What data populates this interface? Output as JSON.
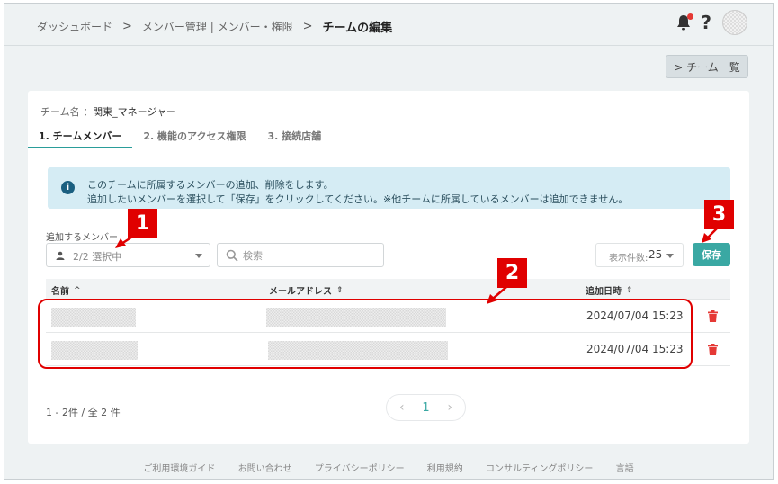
{
  "breadcrumb": {
    "items": [
      "ダッシュボード",
      "メンバー管理 | メンバー・権限"
    ],
    "separator": ">",
    "current": "チームの編集"
  },
  "header": {
    "bell_icon": "bell-icon",
    "help_label": "?"
  },
  "team_list_button": "> チーム一覧",
  "team": {
    "label": "チーム名",
    "value": "：関東_マネージャー"
  },
  "tabs": [
    {
      "label": "1. チームメンバー",
      "active": true
    },
    {
      "label": "2. 機能のアクセス権限",
      "active": false
    },
    {
      "label": "3. 接続店舗",
      "active": false
    }
  ],
  "alert": {
    "line1": "このチームに所属するメンバーの追加、削除をします。",
    "line2": "追加したいメンバーを選択して「保存」をクリックしてください。※他チームに所属しているメンバーは追加できません。"
  },
  "member_select": {
    "label": "追加するメンバー",
    "value": "2/2 選択中"
  },
  "search": {
    "placeholder": "検索"
  },
  "per_page": {
    "label": "表示件数:",
    "value": "25"
  },
  "save_label": "保存",
  "table": {
    "columns": [
      {
        "label": "名前",
        "sort": "^"
      },
      {
        "label": "メールアドレス",
        "sort": "⇕"
      },
      {
        "label": "追加日時",
        "sort": "⇕"
      }
    ],
    "rows": [
      {
        "name": "",
        "email": "",
        "added": "2024/07/04 15:23"
      },
      {
        "name": "",
        "email": "",
        "added": "2024/07/04 15:23"
      }
    ]
  },
  "pagination": {
    "summary": "1 - 2件 / 全 2 件",
    "current_page": "1",
    "prev": "‹",
    "next": "›"
  },
  "footer_links": [
    "ご利用環境ガイド",
    "お問い合わせ",
    "プライバシーポリシー",
    "利用規約",
    "コンサルティングポリシー",
    "言語"
  ],
  "annotations": {
    "m1": "1",
    "m2": "2",
    "m3": "3"
  },
  "colors": {
    "accent": "#3aa8a3",
    "annotation": "#e00000",
    "delete": "#e53935"
  }
}
